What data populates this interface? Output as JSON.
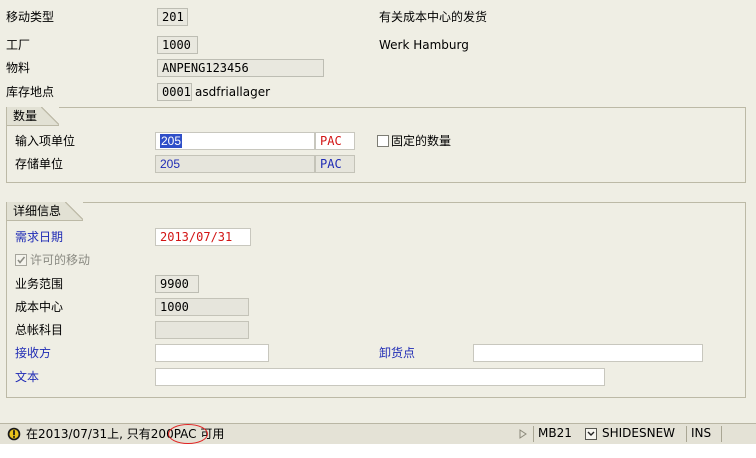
{
  "header": {
    "movement_type": {
      "label": "移动类型",
      "value": "201",
      "desc": "有关成本中心的发货"
    },
    "plant": {
      "label": "工厂",
      "value": "1000",
      "desc": "Werk Hamburg"
    },
    "material": {
      "label": "物料",
      "value": "ANPENG123456"
    },
    "storage_location": {
      "label": "库存地点",
      "value": "0001",
      "desc": "asdfriallager"
    }
  },
  "quantity": {
    "title": "数量",
    "entry_unit": {
      "label": "输入项单位",
      "value": "205",
      "unit": "PAC"
    },
    "stock_unit": {
      "label": "存储单位",
      "value": "205",
      "unit": "PAC"
    },
    "fixed_qty": {
      "label": "固定的数量",
      "checked": false
    }
  },
  "details": {
    "title": "详细信息",
    "req_date": {
      "label": "需求日期",
      "value": "2013/07/31"
    },
    "movement_allowed": {
      "label": "许可的移动",
      "checked": true
    },
    "business_area": {
      "label": "业务范围",
      "value": "9900"
    },
    "cost_center": {
      "label": "成本中心",
      "value": "1000"
    },
    "gl_account": {
      "label": "总帐科目",
      "value": ""
    },
    "recipient": {
      "label": "接收方",
      "value": ""
    },
    "unloading_point": {
      "label": "卸货点",
      "value": ""
    },
    "text": {
      "label": "文本",
      "value": ""
    }
  },
  "status_bar": {
    "message_prefix": "在2013/07/31上, 只有",
    "message_qty": "200",
    "message_suffix": "PAC 可用",
    "transaction": "MB21",
    "server": "SHIDESNEW",
    "mode": "INS"
  },
  "colors": {
    "label_blue": "#1f2bb5",
    "required_red": "#d21414",
    "highlight_circle": "#e02020",
    "selection_blue": "#2f4fc8"
  }
}
